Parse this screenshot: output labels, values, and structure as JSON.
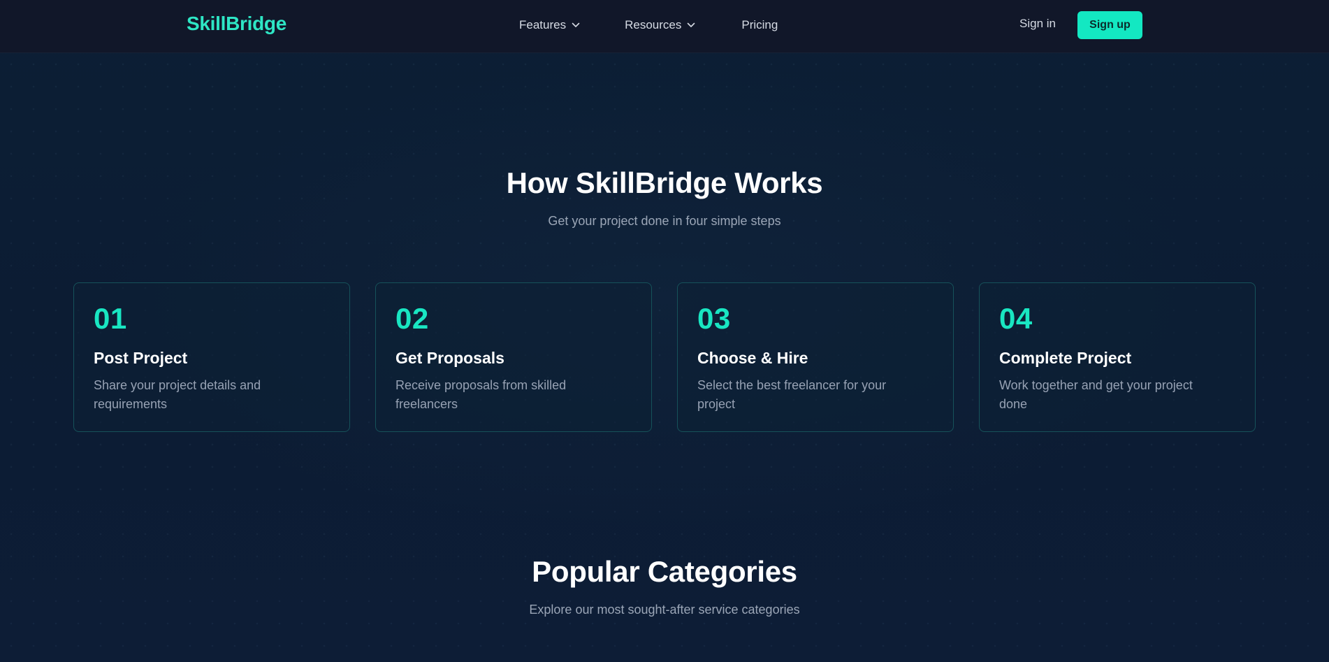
{
  "nav": {
    "logo": "SkillBridge",
    "features": "Features",
    "resources": "Resources",
    "pricing": "Pricing",
    "signin": "Sign in",
    "signup": "Sign up"
  },
  "how": {
    "title": "How SkillBridge Works",
    "subtitle": "Get your project done in four simple steps",
    "steps": [
      {
        "num": "01",
        "title": "Post Project",
        "desc": "Share your project details and requirements"
      },
      {
        "num": "02",
        "title": "Get Proposals",
        "desc": "Receive proposals from skilled freelancers"
      },
      {
        "num": "03",
        "title": "Choose & Hire",
        "desc": "Select the best freelancer for your project"
      },
      {
        "num": "04",
        "title": "Complete Project",
        "desc": "Work together and get your project done"
      }
    ]
  },
  "categories": {
    "title": "Popular Categories",
    "subtitle": "Explore our most sought-after service categories"
  },
  "colors": {
    "accent": "#13e8c2",
    "background": "#0c1c33",
    "navbar": "#111729"
  }
}
